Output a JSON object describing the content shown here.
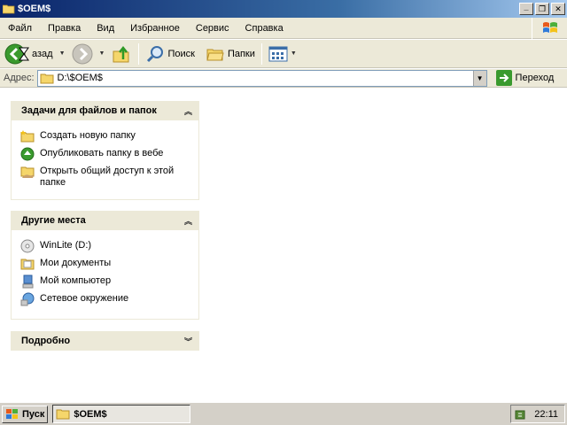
{
  "window": {
    "title": "$OEM$",
    "controls": {
      "minimize": "_",
      "maximize": "❐",
      "close": "✕"
    }
  },
  "menu": {
    "items": [
      "Файл",
      "Правка",
      "Вид",
      "Избранное",
      "Сервис",
      "Справка"
    ]
  },
  "toolbar": {
    "back_label": "азад",
    "search_label": "Поиск",
    "folders_label": "Папки"
  },
  "address": {
    "label": "Адрес:",
    "value": "D:\\$OEM$",
    "go_label": "Переход"
  },
  "tasks_group": {
    "title": "Задачи для файлов и папок",
    "items": [
      {
        "label": "Создать новую папку",
        "icon": "new-folder-icon"
      },
      {
        "label": "Опубликовать папку в вебе",
        "icon": "publish-web-icon"
      },
      {
        "label": "Открыть общий доступ к этой папке",
        "icon": "share-folder-icon"
      }
    ]
  },
  "places_group": {
    "title": "Другие места",
    "items": [
      {
        "label": "WinLite (D:)",
        "icon": "drive-icon"
      },
      {
        "label": "Мои документы",
        "icon": "my-documents-icon"
      },
      {
        "label": "Мой компьютер",
        "icon": "my-computer-icon"
      },
      {
        "label": "Сетевое окружение",
        "icon": "network-icon"
      }
    ]
  },
  "details_group": {
    "title": "Подробно"
  },
  "taskbar": {
    "start_label": "Пуск",
    "task_label": "$OEM$",
    "clock": "22:11"
  },
  "colors": {
    "title_bar": "#0a246a",
    "pane_header": "#ece9d8",
    "chrome": "#ece9d8"
  }
}
